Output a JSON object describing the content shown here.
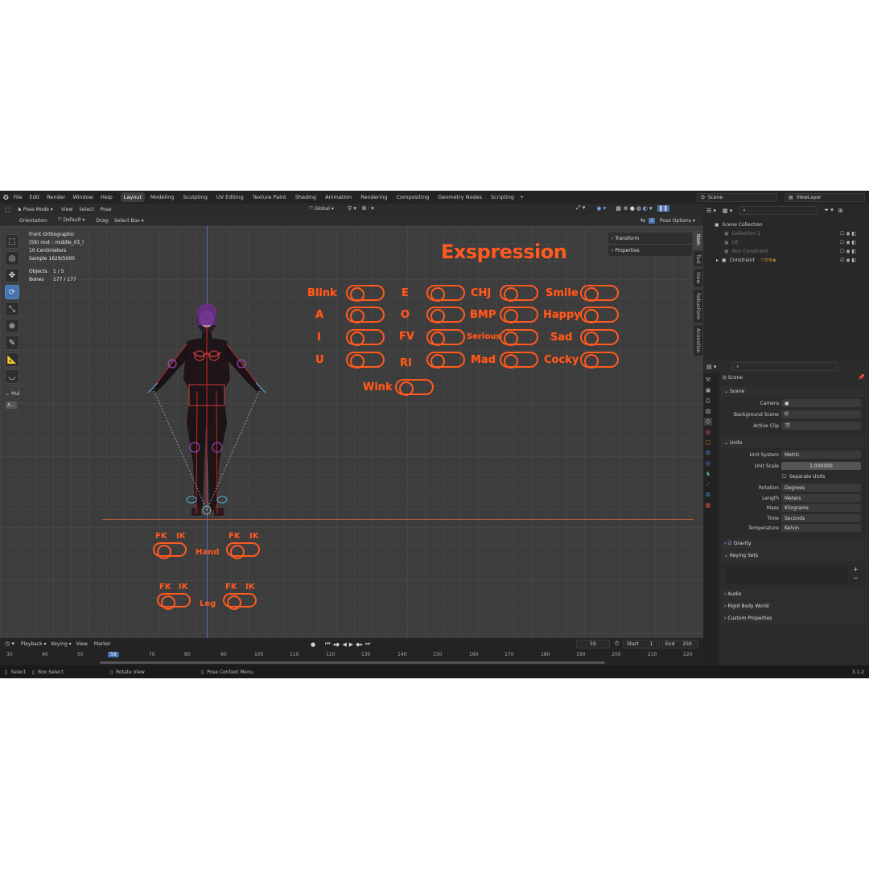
{
  "menu": {
    "items": [
      "File",
      "Edit",
      "Render",
      "Window",
      "Help"
    ]
  },
  "workspaces": {
    "tabs": [
      "Layout",
      "Modeling",
      "Sculpting",
      "UV Editing",
      "Texture Paint",
      "Shading",
      "Animation",
      "Rendering",
      "Compositing",
      "Geometry Nodes",
      "Scripting"
    ],
    "add": "+",
    "active": "Layout"
  },
  "scene": {
    "name": "Scene",
    "view_layer": "ViewLayer"
  },
  "header": {
    "mode": "Pose Mode",
    "menus": [
      "View",
      "Select",
      "Pose"
    ],
    "transform_orientation": "Global"
  },
  "tool_header": {
    "orientation_label": "Orientation:",
    "orientation_value": "Default",
    "drag_label": "Drag:",
    "drag_value": "Select Box",
    "pose_options": "Pose Options"
  },
  "overlay": {
    "view_name": "Front Orthographic",
    "active_bone": "(59) root : middle_03_l",
    "scale": "10 Centimeters",
    "samples": "Sample 1629/5000",
    "objects_label": "Objects",
    "objects_value": "1 / 5",
    "bones_label": "Bones",
    "bones_value": "177 / 177"
  },
  "left_panel": {
    "mul": "Mul",
    "a_button": "A..."
  },
  "npanel": {
    "transform": "Transform",
    "properties": "Properties"
  },
  "vtabs": [
    "Item",
    "Tool",
    "View",
    "RebusFarm",
    "Animation"
  ],
  "rig_ui": {
    "title": "Exspression",
    "expressions": {
      "col1": [
        "Blink",
        "A",
        "I",
        "U"
      ],
      "col2": [
        "E",
        "O",
        "FV",
        "RI"
      ],
      "col3": [
        "CHJ",
        "BMP",
        "Serious",
        "Mad"
      ],
      "col4": [
        "Smile",
        "Happy",
        "Sad",
        "Cocky"
      ],
      "wink": "Wink"
    },
    "hand": {
      "label": "Hand",
      "fk": "FK",
      "ik": "IK"
    },
    "leg": {
      "label": "Leg",
      "fk": "FK",
      "ik": "IK"
    }
  },
  "outliner": {
    "root": "Scene Collection",
    "items": [
      {
        "name": "Collection 2",
        "dim": true
      },
      {
        "name": "UE",
        "dim": true
      },
      {
        "name": "Non Constraint",
        "dim": true
      },
      {
        "name": "Constraint",
        "dim": false
      }
    ]
  },
  "properties": {
    "breadcrumb": "Scene",
    "scene_section": "Scene",
    "camera_label": "Camera",
    "background_scene_label": "Background Scene",
    "active_clip_label": "Active Clip",
    "units_section": "Units",
    "unit_system_label": "Unit System",
    "unit_system": "Metric",
    "unit_scale_label": "Unit Scale",
    "unit_scale": "1.000000",
    "separate_units": "Separate Units",
    "rotation_label": "Rotation",
    "rotation": "Degrees",
    "length_label": "Length",
    "length": "Meters",
    "mass_label": "Mass",
    "mass": "Kilograms",
    "time_label": "Time",
    "time": "Seconds",
    "temperature_label": "Temperature",
    "temperature": "Kelvin",
    "gravity": "Gravity",
    "keying_sets": "Keying Sets",
    "audio": "Audio",
    "rigid_body_world": "Rigid Body World",
    "custom_properties": "Custom Properties"
  },
  "timeline": {
    "menus": [
      "Playback",
      "Keying",
      "View",
      "Marker"
    ],
    "current_frame": "59",
    "start_label": "Start",
    "start": "1",
    "end_label": "End",
    "end": "250",
    "ruler": [
      "30",
      "40",
      "50",
      "59",
      "70",
      "80",
      "90",
      "100",
      "110",
      "120",
      "130",
      "140",
      "150",
      "160",
      "170",
      "180",
      "190",
      "200",
      "210",
      "220"
    ]
  },
  "status": {
    "select": "Select",
    "box_select": "Box Select",
    "rotate_view": "Rotate View",
    "pose_context_menu": "Pose Context Menu",
    "version": "3.1.2"
  },
  "colors": {
    "accent": "#4772b3",
    "rig_ui": "#ff5a1f",
    "viewport": "#3d3d3d"
  }
}
